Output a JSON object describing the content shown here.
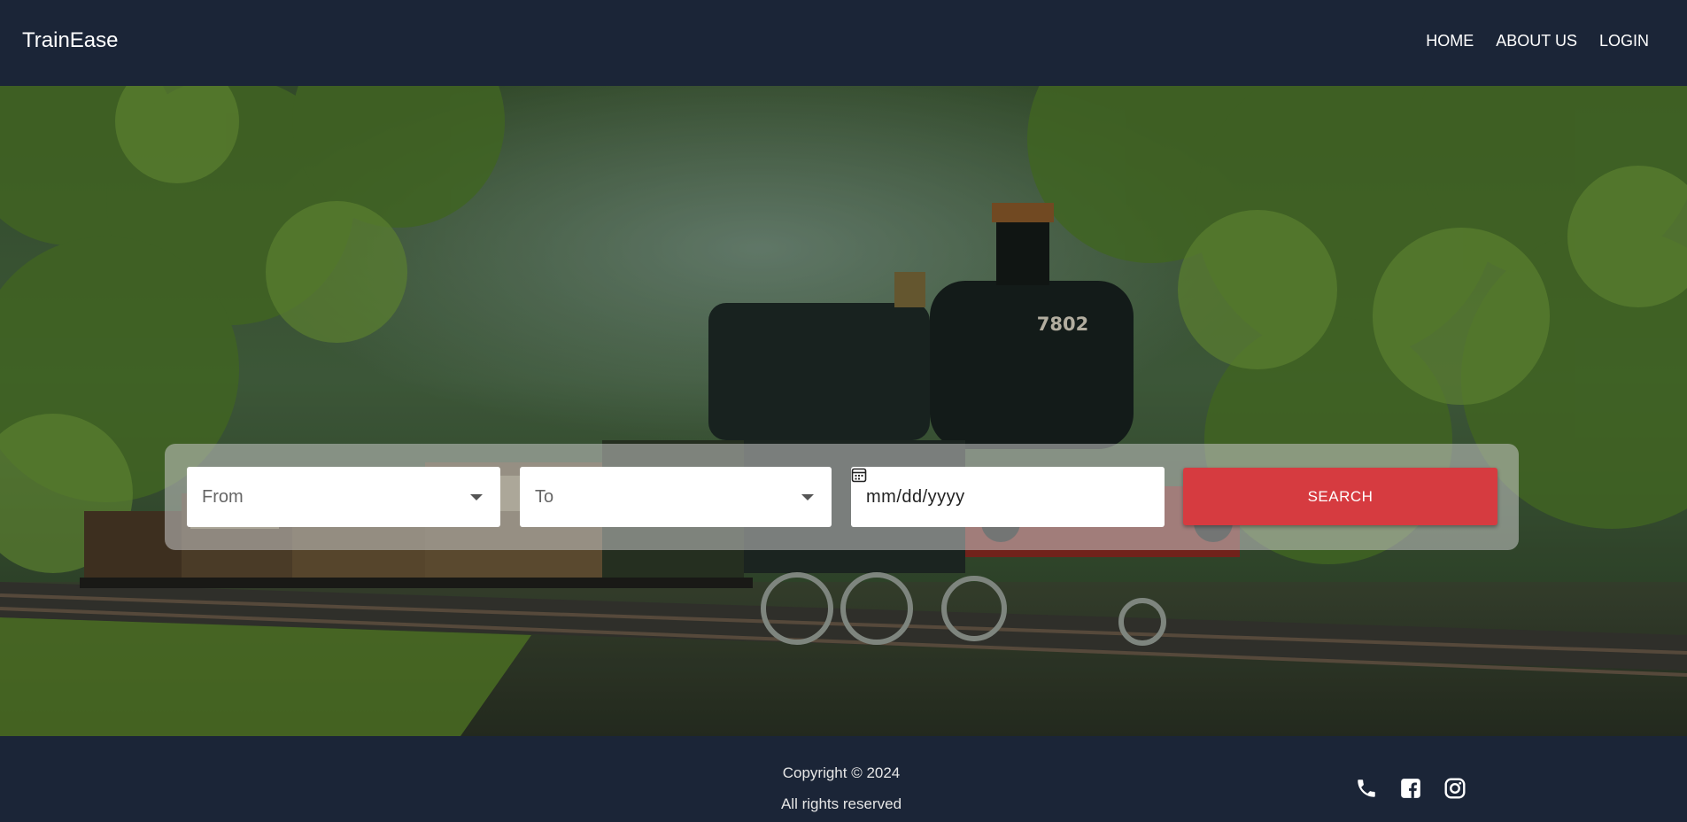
{
  "navbar": {
    "brand": "TrainEase",
    "links": [
      "HOME",
      "ABOUT US",
      "LOGIN"
    ]
  },
  "hero": {
    "locomotive_number": "7802"
  },
  "search": {
    "from_placeholder": "From",
    "to_placeholder": "To",
    "date_placeholder": "mm/dd/yyyy",
    "button_label": "SEARCH"
  },
  "footer": {
    "copyright": "Copyright © 2024",
    "rights": "All rights reserved",
    "social_icons": [
      "phone-icon",
      "facebook-icon",
      "instagram-icon"
    ]
  },
  "colors": {
    "header_bg": "#1b2537",
    "accent": "#d63b40"
  }
}
